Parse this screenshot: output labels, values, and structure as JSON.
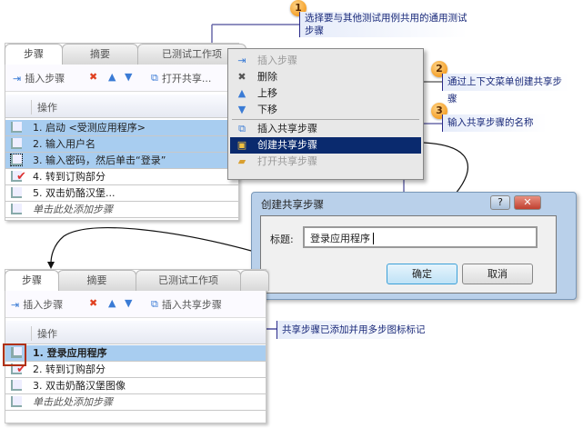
{
  "top_panel": {
    "tabs": [
      "步骤",
      "摘要",
      "已测试工作项"
    ],
    "toolbar": {
      "insert_step": "插入步骤",
      "open_shared": "打开共享..."
    },
    "column_header": "操作",
    "rows": [
      "1. 启动 <受测应用程序>",
      "2. 输入用户名",
      "3. 输入密码，然后单击“登录”",
      "4. 转到订购部分",
      "5. 双击奶酪汉堡..."
    ],
    "add_step": "单击此处添加步骤"
  },
  "context_menu": {
    "items": [
      "插入步骤",
      "删除",
      "上移",
      "下移",
      "插入共享步骤",
      "创建共享步骤",
      "打开共享步骤"
    ]
  },
  "callouts": [
    {
      "num": "1",
      "text": "选择要与其他测试用例共用的通用测试步骤"
    },
    {
      "num": "2",
      "text": "通过上下文菜单创建共享步骤"
    },
    {
      "num": "3",
      "text": "输入共享步骤的名称"
    },
    {
      "text": "共享步骤已添加并用多步图标标记"
    }
  ],
  "dialog": {
    "title": "创建共享步骤",
    "help": "?",
    "close": "✕",
    "label": "标题:",
    "value": "登录应用程序",
    "ok": "确定",
    "cancel": "取消"
  },
  "bottom_panel": {
    "tabs": [
      "步骤",
      "摘要",
      "已测试工作项"
    ],
    "toolbar": {
      "insert_step": "插入步骤",
      "insert_shared": "插入共享步骤"
    },
    "column_header": "操作",
    "rows": [
      "1. 登录应用程序",
      "2. 转到订购部分",
      "3. 双击奶酪汉堡图像"
    ],
    "add_step": "单击此处添加步骤"
  }
}
